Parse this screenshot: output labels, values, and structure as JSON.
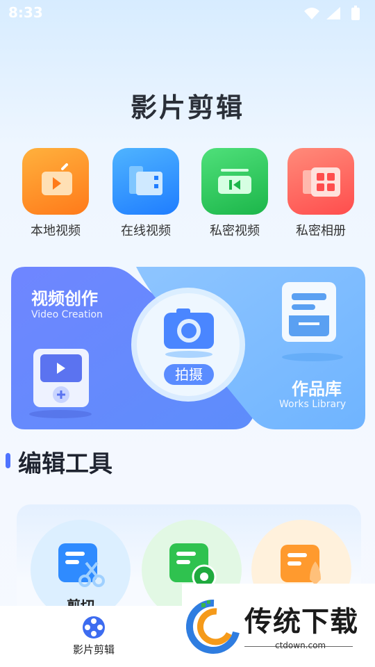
{
  "status_bar": {
    "time": "8:33"
  },
  "app": {
    "title": "影片剪辑"
  },
  "quick_actions": [
    {
      "label": "本地视频",
      "icon": "play-tv-icon",
      "color": "#ff9a2e"
    },
    {
      "label": "在线视频",
      "icon": "film-folder-icon",
      "color": "#2f93ff"
    },
    {
      "label": "私密视频",
      "icon": "rewind-video-icon",
      "color": "#2ec85a"
    },
    {
      "label": "私密相册",
      "icon": "grid-album-icon",
      "color": "#ff6a5c"
    }
  ],
  "feature_card": {
    "create_title": "视频创作",
    "create_subtitle": "Video Creation",
    "shoot_label": "拍摄",
    "works_title": "作品库",
    "works_subtitle": "Works Library"
  },
  "tools_section": {
    "title": "编辑工具",
    "items": [
      {
        "label": "剪切",
        "icon": "scissors-icon"
      },
      {
        "label": "",
        "icon": "filter-icon"
      },
      {
        "label": "",
        "icon": "rocket-icon"
      }
    ]
  },
  "bottom_nav": {
    "label": "影片剪辑"
  },
  "watermark": {
    "text": "传统下载",
    "url": "ctdown.com"
  }
}
